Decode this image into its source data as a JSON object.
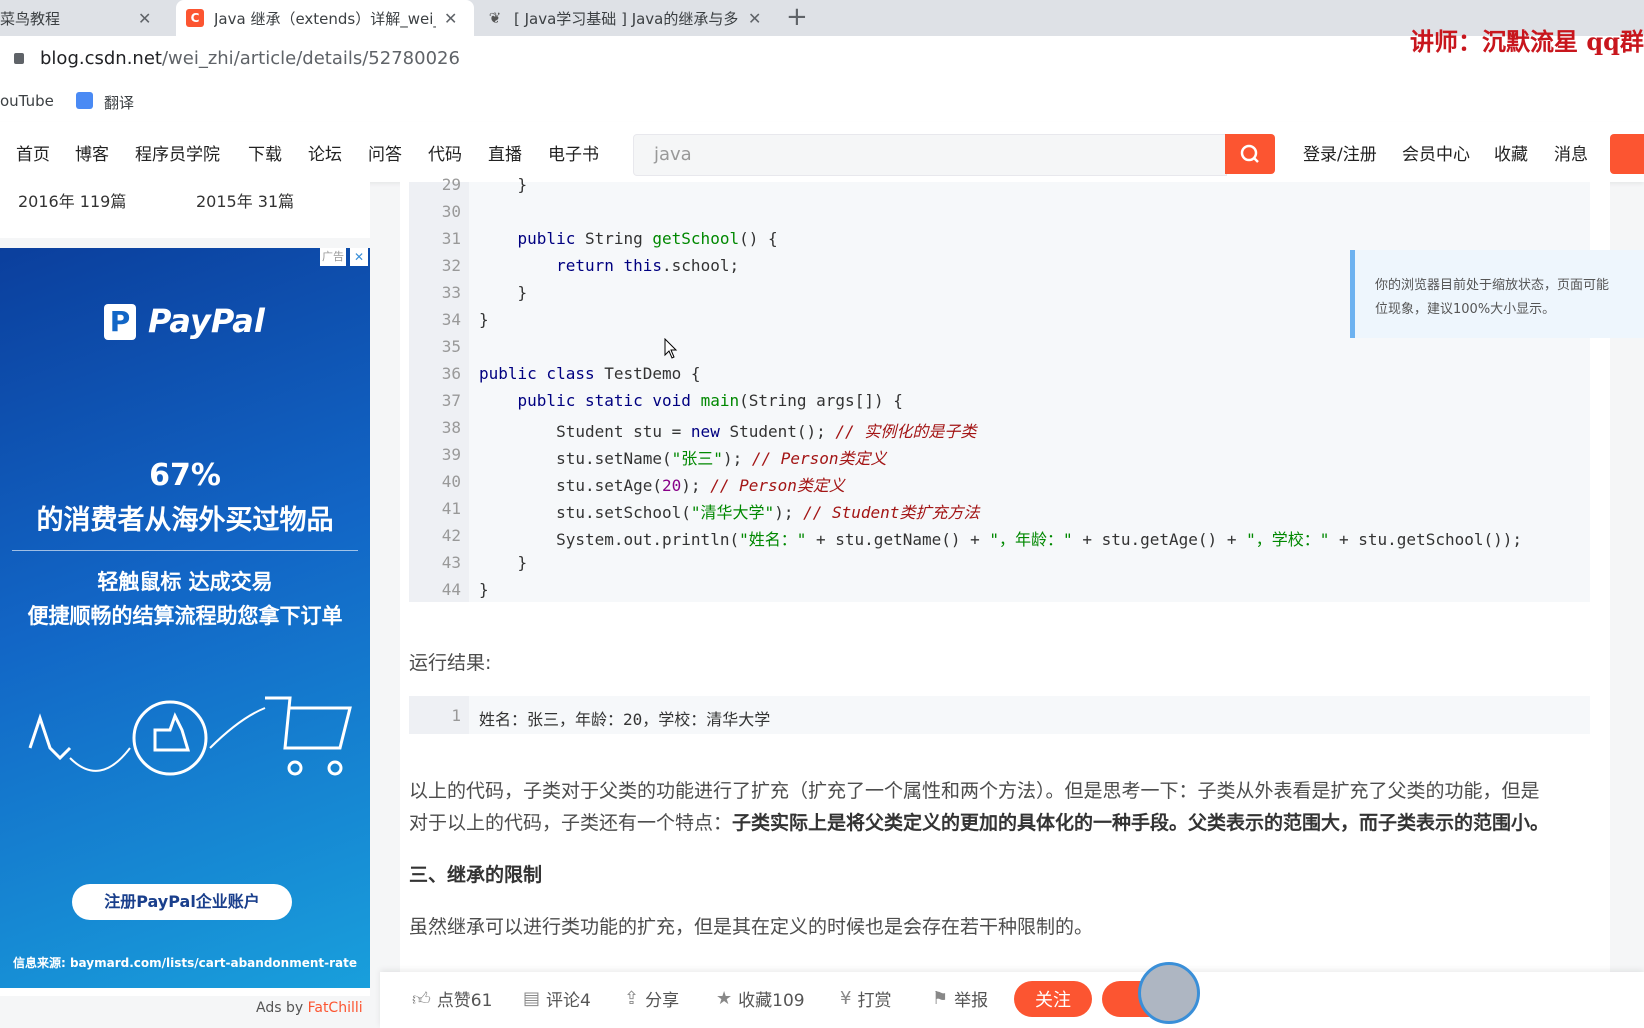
{
  "browser": {
    "tabs": [
      {
        "title": "菜鸟教程"
      },
      {
        "title": "Java 继承（extends）详解_wei_"
      },
      {
        "title": "[ Java学习基础 ] Java的继承与多"
      }
    ],
    "new_tab": "+",
    "url_host": "blog.csdn.net",
    "url_path": "/wei_zhi/article/details/52780026",
    "bookmarks": [
      {
        "label": "ouTube"
      },
      {
        "label": "翻译"
      }
    ]
  },
  "watermark": "讲师：沉默流星 qq群：",
  "nav": {
    "items": [
      "首页",
      "博客",
      "程序员学院",
      "下载",
      "论坛",
      "问答",
      "代码",
      "直播",
      "电子书"
    ],
    "search_value": "java",
    "right_items": [
      "登录/注册",
      "会员中心",
      "收藏",
      "消息"
    ]
  },
  "sidebar": {
    "archive": [
      {
        "label": "2016年 119篇"
      },
      {
        "label": "2015年 31篇"
      }
    ],
    "ad": {
      "badge": "广告",
      "brand": "PayPal",
      "percent": "67%",
      "headline": "的消费者从海外买过物品",
      "line1": "轻触鼠标 达成交易",
      "line2": "便捷顺畅的结算流程助您拿下订单",
      "cta": "注册PayPal企业账户",
      "source": "信息来源: baymard.com/lists/cart-abandonment-rate",
      "ads_by": "Ads by",
      "ads_by_brand": "FatChilli"
    }
  },
  "code_block": {
    "line_numbers": [
      "29",
      "30",
      "31",
      "32",
      "33",
      "34",
      "35",
      "36",
      "37",
      "38",
      "39",
      "40",
      "41",
      "42",
      "43",
      "44"
    ]
  },
  "result_label": "运行结果:",
  "result_block": {
    "line": "1",
    "text": "姓名：张三，年龄：20，学校：清华大学"
  },
  "paragraph1_a": "以上的代码，子类对于父类的功能进行了扩充（扩充了一个属性和两个方法）。但是思考一下：子类从外表看是扩充了父类的功能，但是",
  "paragraph1_b": "对于以上的代码，子类还有一个特点：",
  "paragraph1_bold": "子类实际上是将父类定义的更加的具体化的一种手段。父类表示的范围大，而子类表示的范围小。",
  "heading3": "三、继承的限制",
  "paragraph2": "虽然继承可以进行类功能的扩充，但是其在定义的时候也是会存在若干种限制的。",
  "notice": {
    "line1": "你的浏览器目前处于缩放状态，页面可能",
    "line2": "位现象，建议100%大小显示。"
  },
  "toolbar": {
    "like": "点赞61",
    "comment": "评论4",
    "share": "分享",
    "fav": "收藏109",
    "reward": "打赏",
    "report": "举报",
    "follow": "关注"
  }
}
